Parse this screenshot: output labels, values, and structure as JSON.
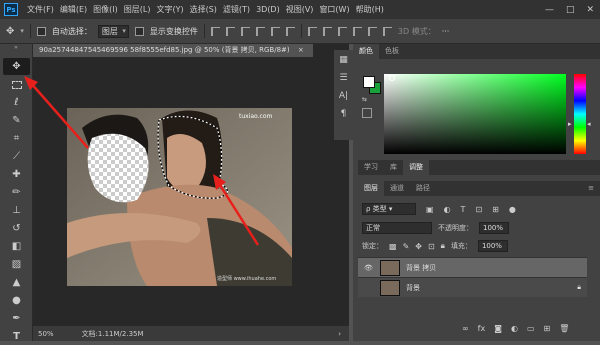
{
  "menubar": {
    "logo": "Ps",
    "items": [
      "文件(F)",
      "编辑(E)",
      "图像(I)",
      "图层(L)",
      "文字(Y)",
      "选择(S)",
      "滤镜(T)",
      "3D(D)",
      "视图(V)",
      "窗口(W)",
      "帮助(H)"
    ],
    "minimize": "—",
    "maximize": "□",
    "close": "✕"
  },
  "options": {
    "auto_select_label": "自动选择：",
    "auto_select_value": "图层",
    "show_transform_label": "显示变换控件",
    "mode_3d_label": "3D 模式：",
    "more": "···"
  },
  "document": {
    "tab_title": "90a25744847545469596 58f8555efd85.jpg @ 50% (背景 拷贝, RGB/8#)",
    "close": "×",
    "zoom": "50%",
    "doc_info": "文档:1.11M/2.35M",
    "watermark_top": "tuxiao.com",
    "watermark_bottom": "造型师 www.ihuahe.com"
  },
  "color_panel": {
    "tab_color": "颜色",
    "tab_swatches": "色板",
    "foreground": "#ffffff",
    "background": "#1aa03a"
  },
  "adjust_tabs": [
    "学习",
    "库",
    "调整"
  ],
  "layers_panel": {
    "tabs": [
      "图层",
      "通道",
      "路径"
    ],
    "kind_label": "类型",
    "blend_mode": "正常",
    "opacity_label": "不透明度：",
    "opacity_value": "100%",
    "lock_label": "锁定：",
    "fill_label": "填充：",
    "fill_value": "100%",
    "layers": [
      {
        "name": "背景 拷贝",
        "visible": true,
        "locked": false
      },
      {
        "name": "背景",
        "visible": false,
        "locked": true
      }
    ]
  },
  "tools": [
    "move-icon",
    "marquee-icon",
    "lasso-icon",
    "quick-select-icon",
    "crop-icon",
    "eyedropper-icon",
    "healing-icon",
    "brush-icon",
    "stamp-icon",
    "history-brush-icon",
    "eraser-icon",
    "gradient-icon",
    "blur-icon",
    "dodge-icon",
    "pen-icon",
    "type-icon",
    "path-select-icon"
  ]
}
